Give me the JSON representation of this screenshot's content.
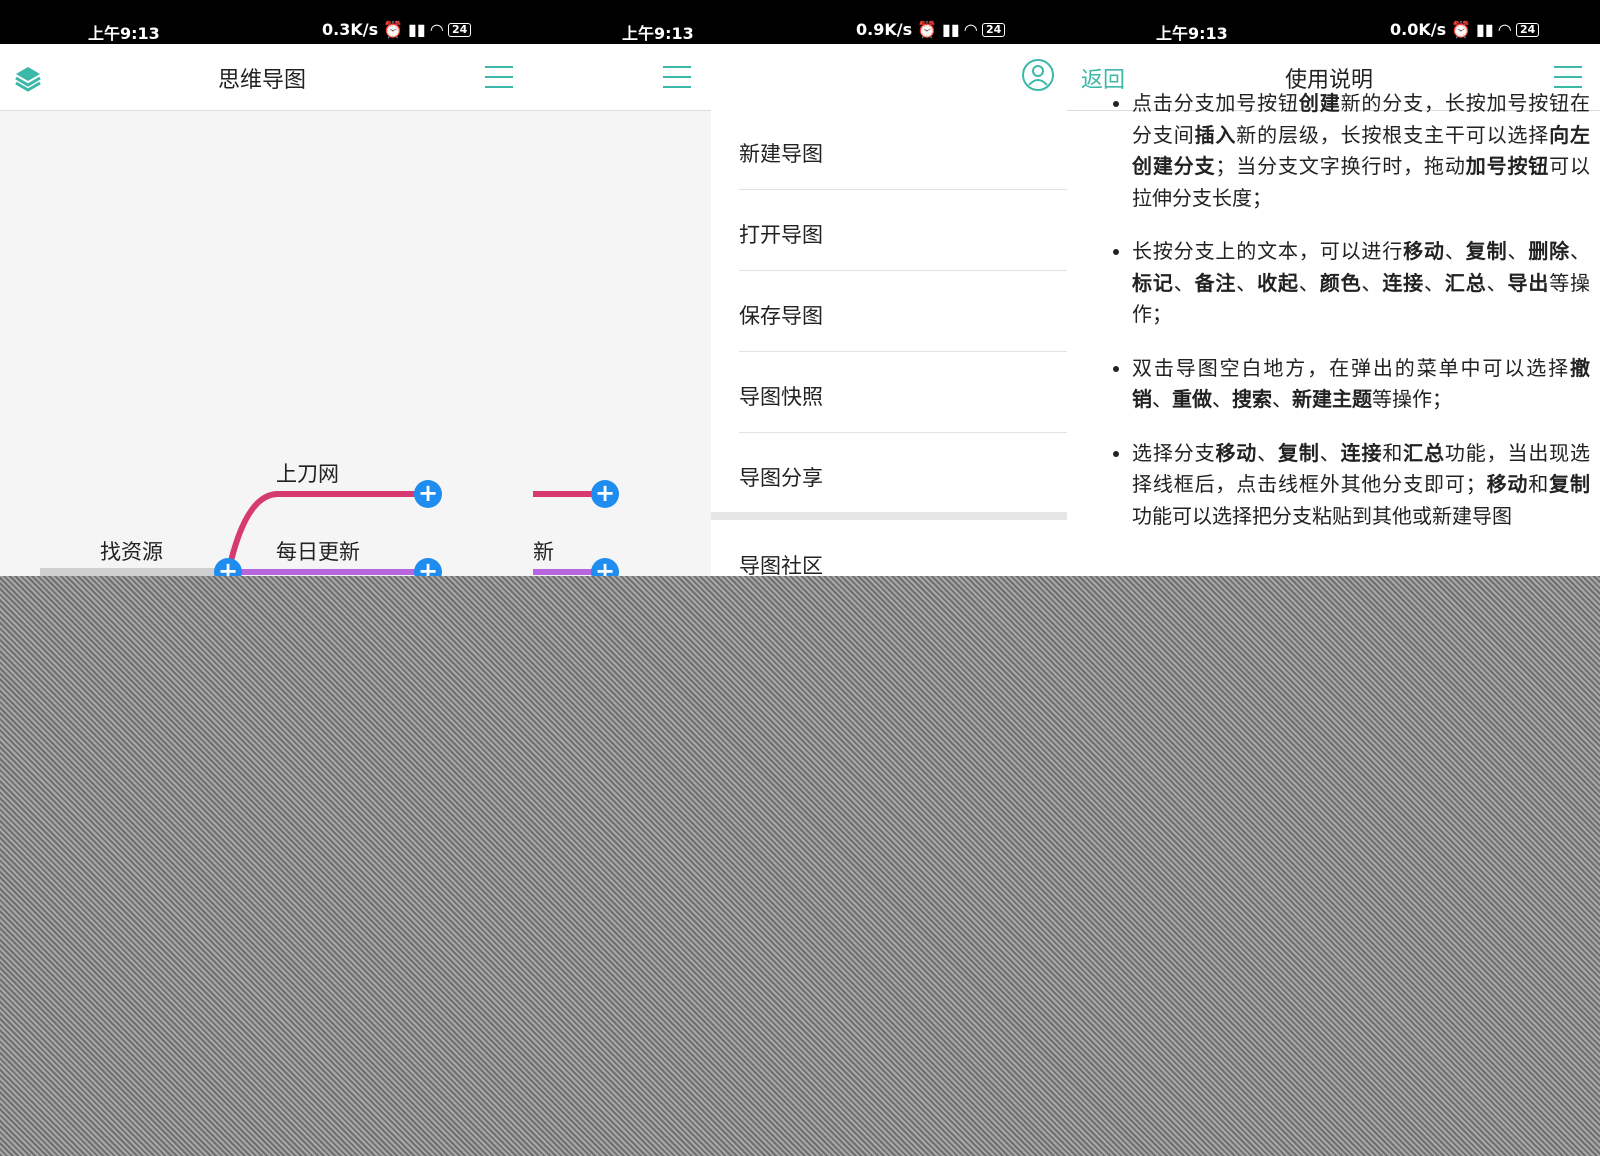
{
  "status": [
    {
      "time": "上午9:13",
      "speed": "0.3K/s",
      "battery": "24"
    },
    {
      "time": "上午9:13",
      "speed": "0.9K/s",
      "battery": "24"
    },
    {
      "time": "上午9:13",
      "speed": "0.0K/s",
      "battery": "24"
    }
  ],
  "panel1": {
    "title": "思维导图",
    "nodes": {
      "root": "找资源",
      "branch1": "上刀网",
      "branch2": "每日更新"
    },
    "colors": {
      "branch1": "#d63a6e",
      "branch2": "#b866e0",
      "plus": "#1f8df0"
    }
  },
  "panel2": {
    "partial_label": "新",
    "menu": [
      "新建导图",
      "打开导图",
      "保存导图",
      "导图快照",
      "导图分享",
      "导图社区"
    ]
  },
  "panel3": {
    "back_label": "返回",
    "title": "使用说明",
    "accent": "#3cb8a8",
    "paragraphs": [
      [
        [
          "点击分支加号按钮",
          false
        ],
        [
          "创建",
          true
        ],
        [
          "新的分支，长按加号按钮在分支间",
          false
        ],
        [
          "插入",
          true
        ],
        [
          "新的层级，长按根支主干可以选择",
          false
        ],
        [
          "向左创建分支",
          true
        ],
        [
          "；当分支文字换行时，拖动",
          false
        ],
        [
          "加号按钮",
          true
        ],
        [
          "可以拉伸分支长度；",
          false
        ]
      ],
      [
        [
          "长按分支上的文本，可以进行",
          false
        ],
        [
          "移动",
          true
        ],
        [
          "、",
          false
        ],
        [
          "复制",
          true
        ],
        [
          "、",
          false
        ],
        [
          "删除",
          true
        ],
        [
          "、",
          false
        ],
        [
          "标记",
          true
        ],
        [
          "、",
          false
        ],
        [
          "备注",
          true
        ],
        [
          "、",
          false
        ],
        [
          "收起",
          true
        ],
        [
          "、",
          false
        ],
        [
          "颜色",
          true
        ],
        [
          "、",
          false
        ],
        [
          "连接",
          true
        ],
        [
          "、",
          false
        ],
        [
          "汇总",
          true
        ],
        [
          "、",
          false
        ],
        [
          "导出",
          true
        ],
        [
          "等操作；",
          false
        ]
      ],
      [
        [
          "双击导图空白地方，在弹出的菜单中可以选择",
          false
        ],
        [
          "撤销",
          true
        ],
        [
          "、",
          false
        ],
        [
          "重做",
          true
        ],
        [
          "、",
          false
        ],
        [
          "搜索",
          true
        ],
        [
          "、",
          false
        ],
        [
          "新建主题",
          true
        ],
        [
          "等操作；",
          false
        ]
      ],
      [
        [
          "选择分支",
          false
        ],
        [
          "移动",
          true
        ],
        [
          "、",
          false
        ],
        [
          "复制",
          true
        ],
        [
          "、",
          false
        ],
        [
          "连接",
          true
        ],
        [
          "和",
          false
        ],
        [
          "汇总",
          true
        ],
        [
          "功能，当出现选择线框后，点击线框外其他分支即可；",
          false
        ],
        [
          "移动",
          true
        ],
        [
          "和",
          false
        ],
        [
          "复制",
          true
        ],
        [
          "功能可以选择把分支粘贴到其他或新建导图",
          false
        ]
      ]
    ]
  }
}
